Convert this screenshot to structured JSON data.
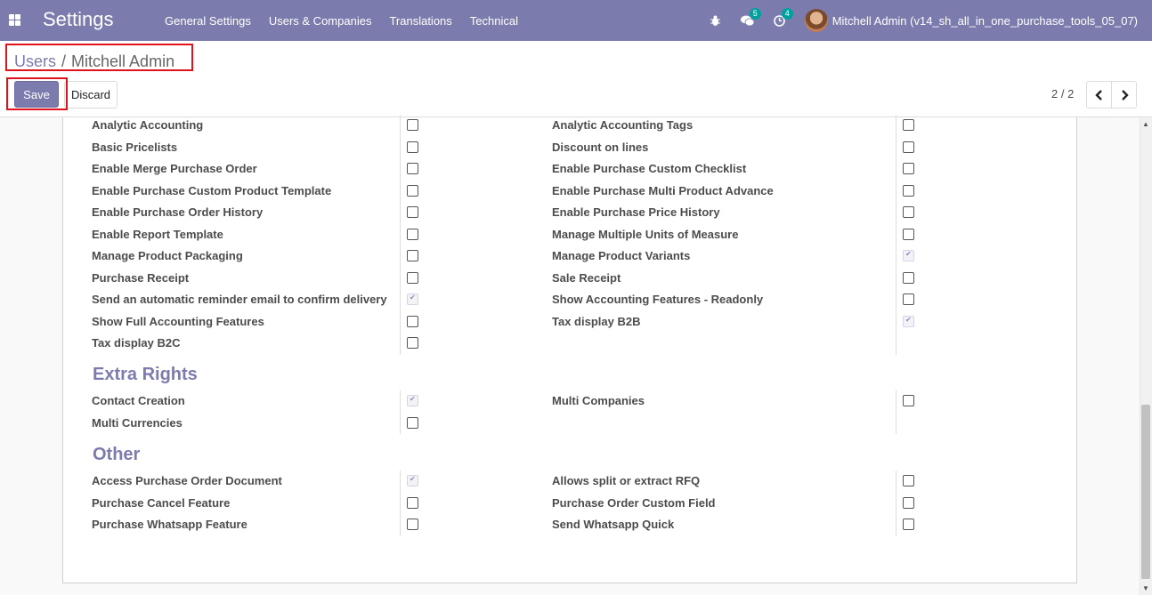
{
  "navbar": {
    "title": "Settings",
    "menu": [
      "General Settings",
      "Users & Companies",
      "Translations",
      "Technical"
    ],
    "messages_count": "5",
    "activities_count": "4",
    "user": "Mitchell Admin (v14_sh_all_in_one_purchase_tools_05_07)"
  },
  "breadcrumb": {
    "parent": "Users",
    "separator": "/",
    "current": "Mitchell Admin"
  },
  "buttons": {
    "save": "Save",
    "discard": "Discard"
  },
  "pager": {
    "value": "2 / 2"
  },
  "settings_rows": [
    {
      "left": "Analytic Accounting",
      "left_checked": false,
      "right": "Analytic Accounting Tags",
      "right_checked": false
    },
    {
      "left": "Basic Pricelists",
      "left_checked": false,
      "right": "Discount on lines",
      "right_checked": false
    },
    {
      "left": "Enable Merge Purchase Order",
      "left_checked": false,
      "right": "Enable Purchase Custom Checklist",
      "right_checked": false
    },
    {
      "left": "Enable Purchase Custom Product Template",
      "left_checked": false,
      "right": "Enable Purchase Multi Product Advance",
      "right_checked": false
    },
    {
      "left": "Enable Purchase Order History",
      "left_checked": false,
      "right": "Enable Purchase Price History",
      "right_checked": false
    },
    {
      "left": "Enable Report Template",
      "left_checked": false,
      "right": "Manage Multiple Units of Measure",
      "right_checked": false
    },
    {
      "left": "Manage Product Packaging",
      "left_checked": false,
      "right": "Manage Product Variants",
      "right_checked": true
    },
    {
      "left": "Purchase Receipt",
      "left_checked": false,
      "right": "Sale Receipt",
      "right_checked": false
    },
    {
      "left": "Send an automatic reminder email to confirm delivery",
      "left_checked": true,
      "right": "Show Accounting Features - Readonly",
      "right_checked": false
    },
    {
      "left": "Show Full Accounting Features",
      "left_checked": false,
      "right": "Tax display B2B",
      "right_checked": true
    },
    {
      "left": "Tax display B2C",
      "left_checked": false,
      "right": "",
      "right_checked": null
    }
  ],
  "extra_rights": {
    "title": "Extra Rights",
    "rows": [
      {
        "left": "Contact Creation",
        "left_checked": true,
        "right": "Multi Companies",
        "right_checked": false
      },
      {
        "left": "Multi Currencies",
        "left_checked": false,
        "right": "",
        "right_checked": null
      }
    ]
  },
  "other": {
    "title": "Other",
    "rows": [
      {
        "left": "Access Purchase Order Document",
        "left_checked": true,
        "right": "Allows split or extract RFQ",
        "right_checked": false
      },
      {
        "left": "Purchase Cancel Feature",
        "left_checked": false,
        "right": "Purchase Order Custom Field",
        "right_checked": false
      },
      {
        "left": "Purchase Whatsapp Feature",
        "left_checked": false,
        "right": "Send Whatsapp Quick",
        "right_checked": false
      }
    ]
  },
  "colors": {
    "brand": "#7c7bad",
    "highlight": "#e0131c",
    "badge": "#00a09d"
  }
}
